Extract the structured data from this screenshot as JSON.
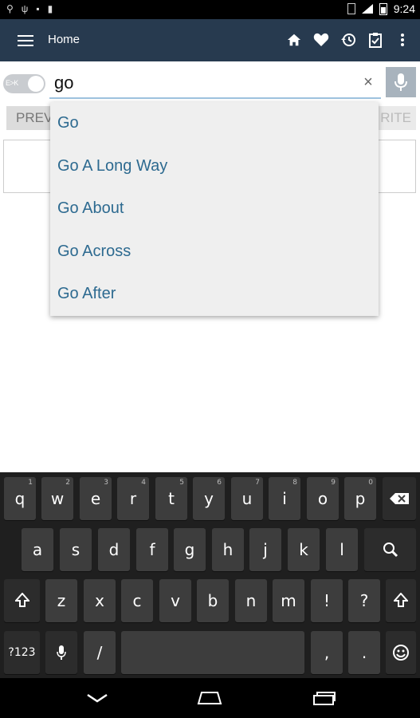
{
  "status_bar": {
    "time": "9:24"
  },
  "app_bar": {
    "title": "Home",
    "icons": [
      "home-icon",
      "favorite-icon",
      "history-icon",
      "clipboard-icon",
      "more-vert-icon"
    ]
  },
  "search": {
    "toggle_label": "E>K",
    "value": "go",
    "clear_glyph": "×"
  },
  "background_buttons": {
    "prev_label": "PREV",
    "fav_label": "RITE"
  },
  "suggestions": [
    "Go",
    "Go A Long Way",
    "Go About",
    "Go Across",
    "Go After"
  ],
  "keyboard": {
    "row1": [
      {
        "label": "q",
        "hint": "1"
      },
      {
        "label": "w",
        "hint": "2"
      },
      {
        "label": "e",
        "hint": "3"
      },
      {
        "label": "r",
        "hint": "4"
      },
      {
        "label": "t",
        "hint": "5"
      },
      {
        "label": "y",
        "hint": "6"
      },
      {
        "label": "u",
        "hint": "7"
      },
      {
        "label": "i",
        "hint": "8"
      },
      {
        "label": "o",
        "hint": "9"
      },
      {
        "label": "p",
        "hint": "0"
      }
    ],
    "row2": [
      "a",
      "s",
      "d",
      "f",
      "g",
      "h",
      "j",
      "k",
      "l"
    ],
    "row3": [
      "z",
      "x",
      "c",
      "v",
      "b",
      "n",
      "m",
      "!",
      "?"
    ],
    "sym_label": "?123",
    "slash_label": "/",
    "comma_label": ",",
    "period_label": "."
  },
  "colors": {
    "app_bar": "#273a4f",
    "suggestion_text": "#2d6a90"
  }
}
